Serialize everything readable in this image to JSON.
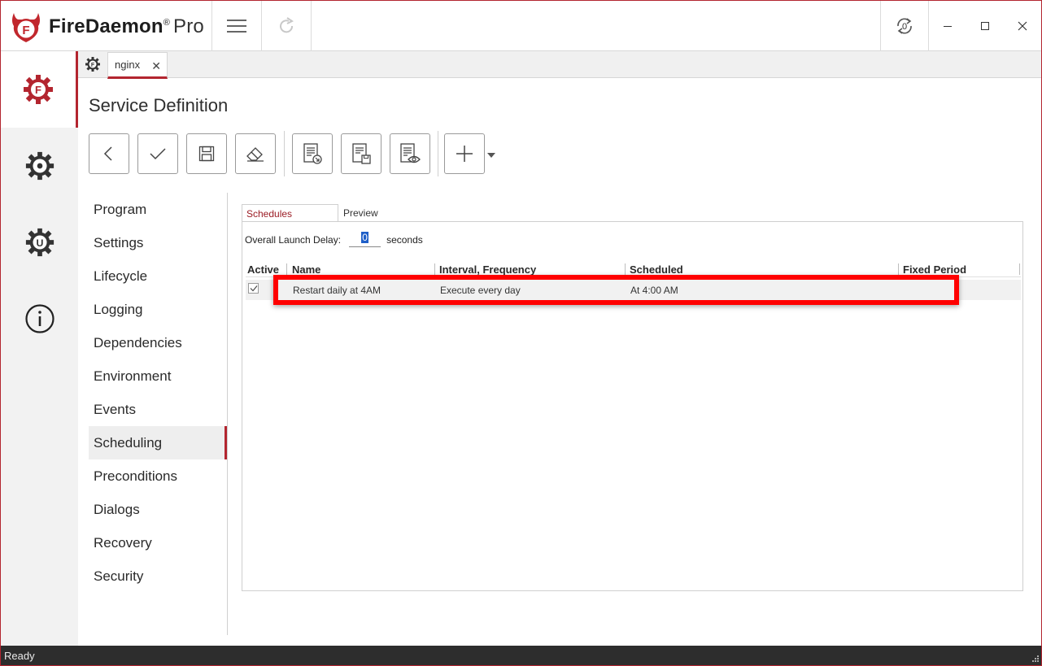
{
  "app": {
    "brand": "FireDaemon",
    "reg": "®",
    "edition": "Pro"
  },
  "titlebar": {
    "buttons": [
      {
        "name": "menu-icon"
      },
      {
        "name": "redo-icon"
      },
      {
        "name": "refresh-counter-icon",
        "counter": "0"
      },
      {
        "name": "minimize-icon"
      },
      {
        "name": "maximize-icon"
      },
      {
        "name": "close-icon"
      }
    ]
  },
  "rail": {
    "items": [
      {
        "name": "firedaemon-services-icon",
        "active": true
      },
      {
        "name": "settings-gear-icon",
        "active": false
      },
      {
        "name": "update-icon",
        "active": false
      },
      {
        "name": "info-icon",
        "active": false
      }
    ]
  },
  "tabs": {
    "doc_label": "nginx"
  },
  "page": {
    "title": "Service Definition"
  },
  "toolbar": {
    "buttons": [
      "back-icon",
      "apply-icon",
      "save-icon",
      "clear-icon",
      "import-icon",
      "export-icon",
      "preview-icon",
      "add-icon"
    ]
  },
  "nav": {
    "items": [
      {
        "label": "Program"
      },
      {
        "label": "Settings"
      },
      {
        "label": "Lifecycle"
      },
      {
        "label": "Logging"
      },
      {
        "label": "Dependencies"
      },
      {
        "label": "Environment"
      },
      {
        "label": "Events"
      },
      {
        "label": "Scheduling",
        "active": true
      },
      {
        "label": "Preconditions"
      },
      {
        "label": "Dialogs"
      },
      {
        "label": "Recovery"
      },
      {
        "label": "Security"
      }
    ]
  },
  "content": {
    "tabs": {
      "schedules": "Schedules",
      "preview": "Preview"
    },
    "delay_label": "Overall Launch Delay:",
    "delay_value": "0",
    "delay_unit": "seconds",
    "columns": {
      "active": "Active",
      "name": "Name",
      "interval": "Interval, Frequency",
      "scheduled": "Scheduled",
      "fixed": "Fixed Period"
    },
    "rows": [
      {
        "active": true,
        "name": "Restart daily at 4AM",
        "interval": "Execute every day",
        "scheduled": "At 4:00 AM",
        "fixed": ""
      }
    ]
  },
  "status": {
    "text": "Ready"
  },
  "colors": {
    "accent": "#b3252f",
    "highlight": "#ff0000",
    "statusbar": "#2d2d2d"
  }
}
